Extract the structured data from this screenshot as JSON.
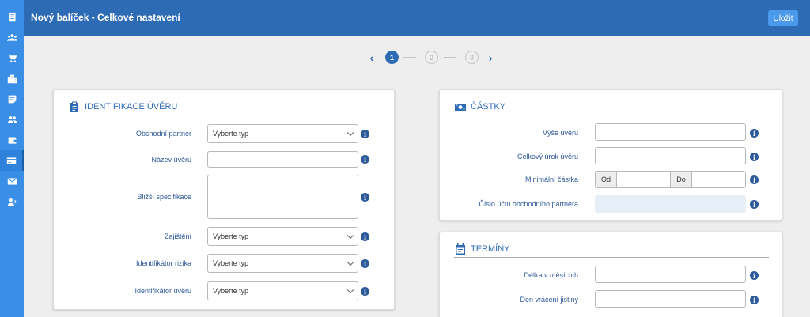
{
  "header": {
    "title": "Nový balíček - Celkové nastavení",
    "save_label": "Uložit"
  },
  "sidebar": {
    "items": [
      {
        "icon": "document-icon"
      },
      {
        "icon": "users-group-icon"
      },
      {
        "icon": "cart-icon"
      },
      {
        "icon": "buildings-icon"
      },
      {
        "icon": "note-icon"
      },
      {
        "icon": "people-icon"
      },
      {
        "icon": "wallet-icon"
      },
      {
        "icon": "card-icon"
      },
      {
        "icon": "mail-icon"
      },
      {
        "icon": "add-user-icon"
      }
    ],
    "active_index": 7
  },
  "stepper": {
    "steps": [
      "1",
      "2",
      "3"
    ],
    "current": 1
  },
  "identifikace": {
    "title": "Identifikace úvěru",
    "obchodni_partner": {
      "label": "Obchodní partner",
      "value": "Vyberte typ"
    },
    "nazev_uveru": {
      "label": "Název úvěru",
      "value": ""
    },
    "blizsi_specifikace": {
      "label": "Bližší specifikace",
      "value": ""
    },
    "zajisteni": {
      "label": "Zajištění",
      "value": "Vyberte typ"
    },
    "identifikator_rizika": {
      "label": "Identifikátor rizika",
      "value": "Vyberte typ"
    },
    "identifikator_uveru": {
      "label": "Identifikátor úvěru",
      "value": "Vyberte typ"
    }
  },
  "castky": {
    "title": "Částky",
    "vyse_uveru": {
      "label": "Výše úvěru",
      "value": ""
    },
    "celkovy_urok": {
      "label": "Celkový úrok úvěru",
      "value": ""
    },
    "minimalni_castka": {
      "label": "Minimální částka",
      "od": "Od",
      "do": "Do"
    },
    "cislo_uctu": {
      "label": "Číslo účtu obchodního partnera",
      "value": ""
    }
  },
  "terminy": {
    "title": "Termíny",
    "delka": {
      "label": "Délka v měsících",
      "value": ""
    },
    "den_vraceni": {
      "label": "Den vrácení jistiny",
      "value": ""
    }
  },
  "info_symbol": "i",
  "colors": {
    "accent": "#2d6bb5",
    "sidebar": "#3a8ee6",
    "label": "#2d5a9a"
  }
}
